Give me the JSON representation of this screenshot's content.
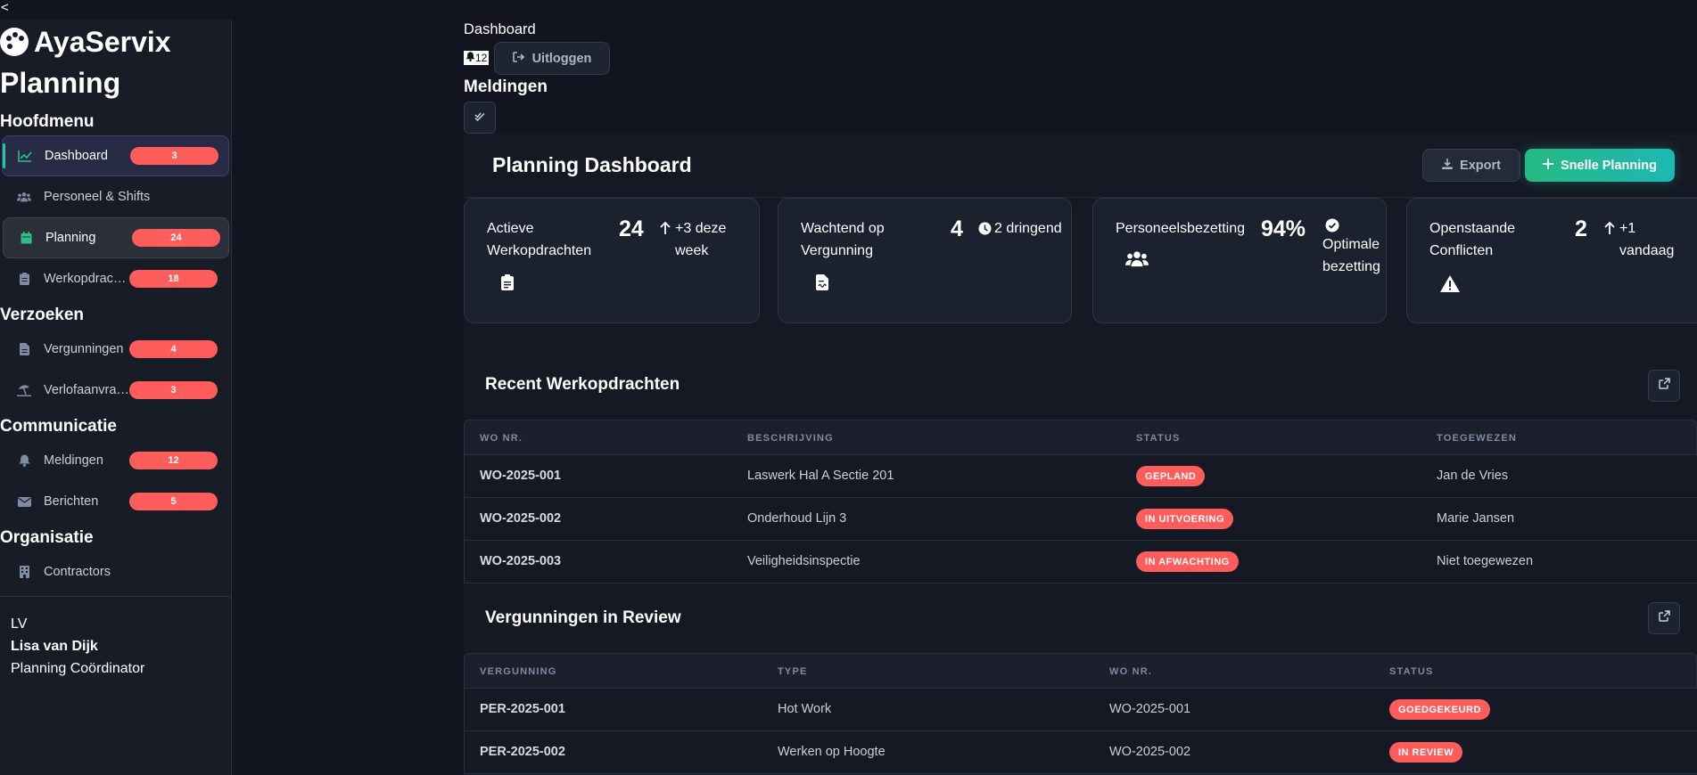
{
  "back": "<",
  "brand": {
    "name": "AyaServix"
  },
  "sidebar": {
    "page_title": "Planning",
    "sections": {
      "hoofdmenu": "Hoofdmenu",
      "verzoeken": "Verzoeken",
      "communicatie": "Communicatie",
      "organisatie": "Organisatie"
    },
    "items": [
      {
        "label": "Dashboard",
        "badge": "3",
        "icon": "chart-line-icon"
      },
      {
        "label": "Personeel & Shifts",
        "icon": "users-icon"
      },
      {
        "label": "Planning",
        "badge": "24",
        "icon": "calendar-icon"
      },
      {
        "label": "Werkopdrachten",
        "badge": "18",
        "icon": "clipboard-icon"
      },
      {
        "label": "Vergunningen",
        "badge": "4",
        "icon": "file-icon"
      },
      {
        "label": "Verlofaanvragen",
        "badge": "3",
        "icon": "umbrella-beach-icon"
      },
      {
        "label": "Meldingen",
        "badge": "12",
        "icon": "bell-icon"
      },
      {
        "label": "Berichten",
        "badge": "5",
        "icon": "envelope-icon"
      },
      {
        "label": "Contractors",
        "icon": "building-icon"
      }
    ],
    "user": {
      "initials": "LV",
      "name": "Lisa van Dijk",
      "role": "Planning Coördinator"
    }
  },
  "topbar": {
    "breadcrumb": "Dashboard",
    "notification_count": "12",
    "logout_label": "Uitloggen",
    "notifications_title": "Meldingen"
  },
  "main": {
    "title": "Planning Dashboard",
    "export_label": "Export",
    "quick_plan_label": "Snelle Planning",
    "stats": [
      {
        "label": "Actieve Werkopdrachten",
        "value": "24",
        "trend": "+3 deze week",
        "icon": "clipboard-list-icon"
      },
      {
        "label": "Wachtend op Vergunning",
        "value": "4",
        "trend": "2 dringend",
        "icon": "file-contract-icon"
      },
      {
        "label": "Personeelsbezetting",
        "value": "94%",
        "trend": "Optimale bezetting",
        "icon": "users-icon"
      },
      {
        "label": "Openstaande Conflicten",
        "value": "2",
        "trend": "+1 vandaag",
        "icon": "warning-icon"
      }
    ],
    "work_orders": {
      "title": "Recent Werkopdrachten",
      "columns": [
        "WO NR.",
        "BESCHRIJVING",
        "STATUS",
        "TOEGEWEZEN"
      ],
      "rows": [
        {
          "nr": "WO-2025-001",
          "desc": "Laswerk Hal A Sectie 201",
          "status": "GEPLAND",
          "assignee": "Jan de Vries"
        },
        {
          "nr": "WO-2025-002",
          "desc": "Onderhoud Lijn 3",
          "status": "IN UITVOERING",
          "assignee": "Marie Jansen"
        },
        {
          "nr": "WO-2025-003",
          "desc": "Veiligheidsinspectie",
          "status": "IN AFWACHTING",
          "assignee": "Niet toegewezen"
        }
      ]
    },
    "permits": {
      "title": "Vergunningen in Review",
      "columns": [
        "VERGUNNING",
        "TYPE",
        "WO NR.",
        "STATUS"
      ],
      "rows": [
        {
          "permit": "PER-2025-001",
          "type": "Hot Work",
          "wo": "WO-2025-001",
          "status": "GOEDGEKEURD"
        },
        {
          "permit": "PER-2025-002",
          "type": "Werken op Hoogte",
          "wo": "WO-2025-002",
          "status": "IN REVIEW"
        }
      ]
    }
  },
  "colors": {
    "background": "#12151f",
    "sidebar": "#181c27",
    "badge": "#ff5c5c",
    "accent_green": "#25b981",
    "accent_teal": "#1eb8b4"
  }
}
